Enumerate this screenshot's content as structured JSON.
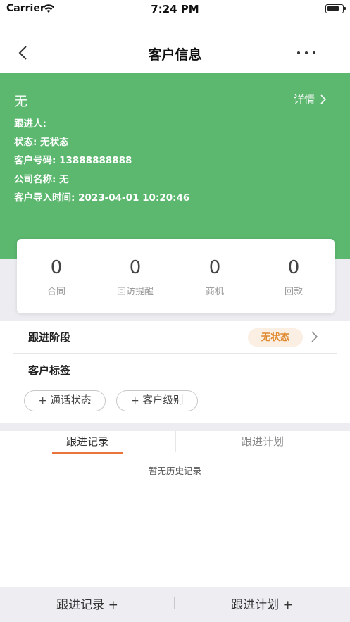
{
  "status_bar": {
    "carrier": "Carrier",
    "time": "7:24 PM",
    "icons": [
      "wifi-icon",
      "battery-icon"
    ]
  },
  "nav": {
    "title": "客户信息",
    "back_icon": "chevron-left-icon",
    "more_icon": "more-horizontal-icon"
  },
  "header": {
    "background": "#5cb76f",
    "customer_name": "无",
    "detail_link": "详情",
    "follower": "跟进人:",
    "status": "状态: 无状态",
    "phone": "客户号码: 13888888888",
    "company": "公司名称: 无",
    "import_time": "客户导入时间: 2023-04-01 10:20:46"
  },
  "stats": [
    {
      "value": "0",
      "label": "合同"
    },
    {
      "value": "0",
      "label": "回访提醒"
    },
    {
      "value": "0",
      "label": "商机"
    },
    {
      "value": "0",
      "label": "回款"
    }
  ],
  "follow_stage": {
    "label": "跟进阶段",
    "badge": "无状态",
    "badge_color": "#e0892e"
  },
  "customer_tags": {
    "label": "客户标签",
    "buttons": [
      "+ 通话状态",
      "+ 客户级别"
    ]
  },
  "tabs": [
    {
      "label": "跟进记录",
      "active": true
    },
    {
      "label": "跟进计划",
      "active": false
    }
  ],
  "tab_accent": "#e8743b",
  "empty_message": "暂无历史记录",
  "bottom_actions": [
    "跟进记录 +",
    "跟进计划 +"
  ]
}
